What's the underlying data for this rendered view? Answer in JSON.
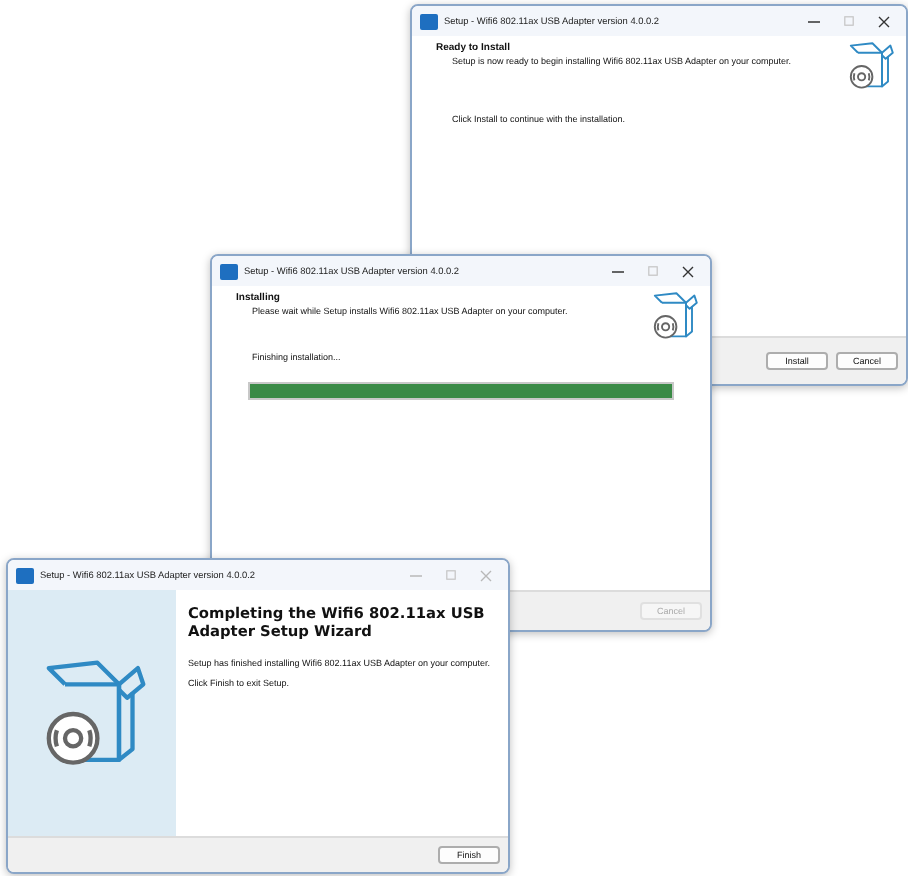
{
  "windows": [
    {
      "kind": "ready",
      "title": "Setup - Wifi6 802.11ax USB Adapter version 4.0.0.2",
      "controls_disabled": false,
      "heading": "Ready to Install",
      "subheading": "Setup is now ready to begin installing Wifi6 802.11ax USB Adapter on your computer.",
      "body": [
        "Click Install to continue with the installation."
      ],
      "buttons": [
        {
          "label": "Install",
          "disabled": false
        },
        {
          "label": "Cancel",
          "disabled": false
        }
      ]
    },
    {
      "kind": "progress",
      "title": "Setup - Wifi6 802.11ax USB Adapter version 4.0.0.2",
      "controls_disabled": false,
      "heading": "Installing",
      "subheading": "Please wait while Setup installs Wifi6 802.11ax USB Adapter on your computer.",
      "status": "Finishing installation...",
      "level": 1,
      "buttons": [
        {
          "label": "Cancel",
          "disabled": true
        }
      ]
    },
    {
      "kind": "finish",
      "title": "Setup - Wifi6 802.11ax USB Adapter version 4.0.0.2",
      "controls_disabled": true,
      "heading": "Completing the Wifi6 802.11ax USB Adapter Setup Wizard",
      "body": [
        "Setup has finished installing Wifi6 802.11ax USB Adapter on your computer.",
        "Click Finish to exit Setup."
      ],
      "buttons": [
        {
          "label": "Finish",
          "disabled": false
        }
      ]
    }
  ]
}
